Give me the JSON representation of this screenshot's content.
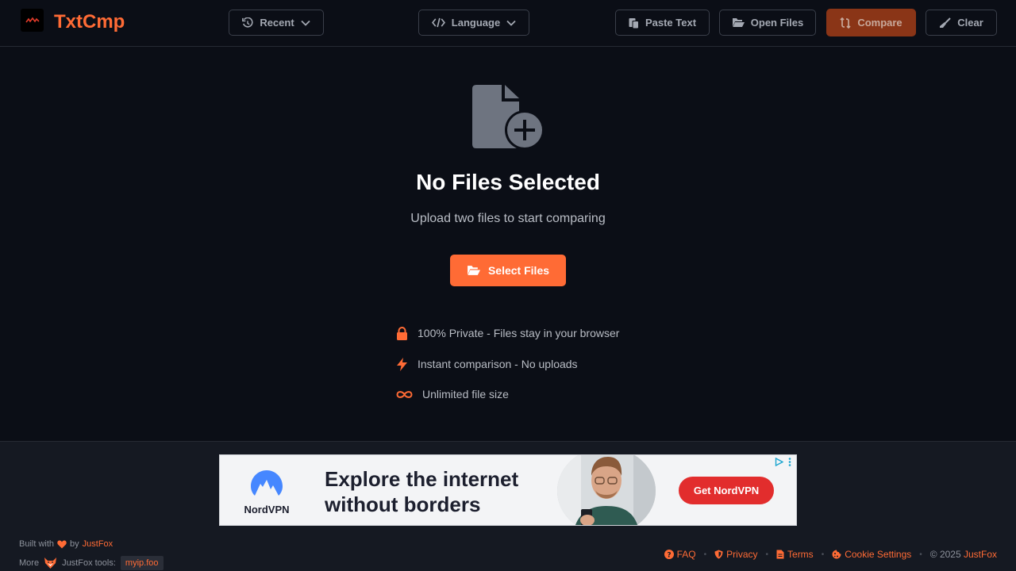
{
  "app": {
    "name": "TxtCmp"
  },
  "header": {
    "recent_label": "Recent",
    "language_label": "Language",
    "paste_label": "Paste Text",
    "open_label": "Open Files",
    "compare_label": "Compare",
    "clear_label": "Clear"
  },
  "main": {
    "title": "No Files Selected",
    "subtitle": "Upload two files to start comparing",
    "select_label": "Select Files",
    "features": [
      {
        "icon": "lock-icon",
        "text": "100% Private - Files stay in your browser"
      },
      {
        "icon": "bolt-icon",
        "text": "Instant comparison - No uploads"
      },
      {
        "icon": "infinity-icon",
        "text": "Unlimited file size"
      }
    ]
  },
  "ad": {
    "brand": "NordVPN",
    "headline_line1": "Explore the internet",
    "headline_line2": "without borders",
    "cta": "Get NordVPN"
  },
  "footer": {
    "built_with": "Built with",
    "by": "by",
    "author": "JustFox",
    "more": "More",
    "tools_label": "JustFox tools:",
    "tool_link": "myip.foo",
    "links": {
      "faq": "FAQ",
      "privacy": "Privacy",
      "terms": "Terms",
      "cookie": "Cookie Settings"
    },
    "copyright": "© 2025",
    "copyright_owner": "JustFox"
  },
  "colors": {
    "accent": "#ff6b35",
    "background": "#0b0e16",
    "compare_button": "#8a3517",
    "ad_cta": "#e22d2d"
  }
}
